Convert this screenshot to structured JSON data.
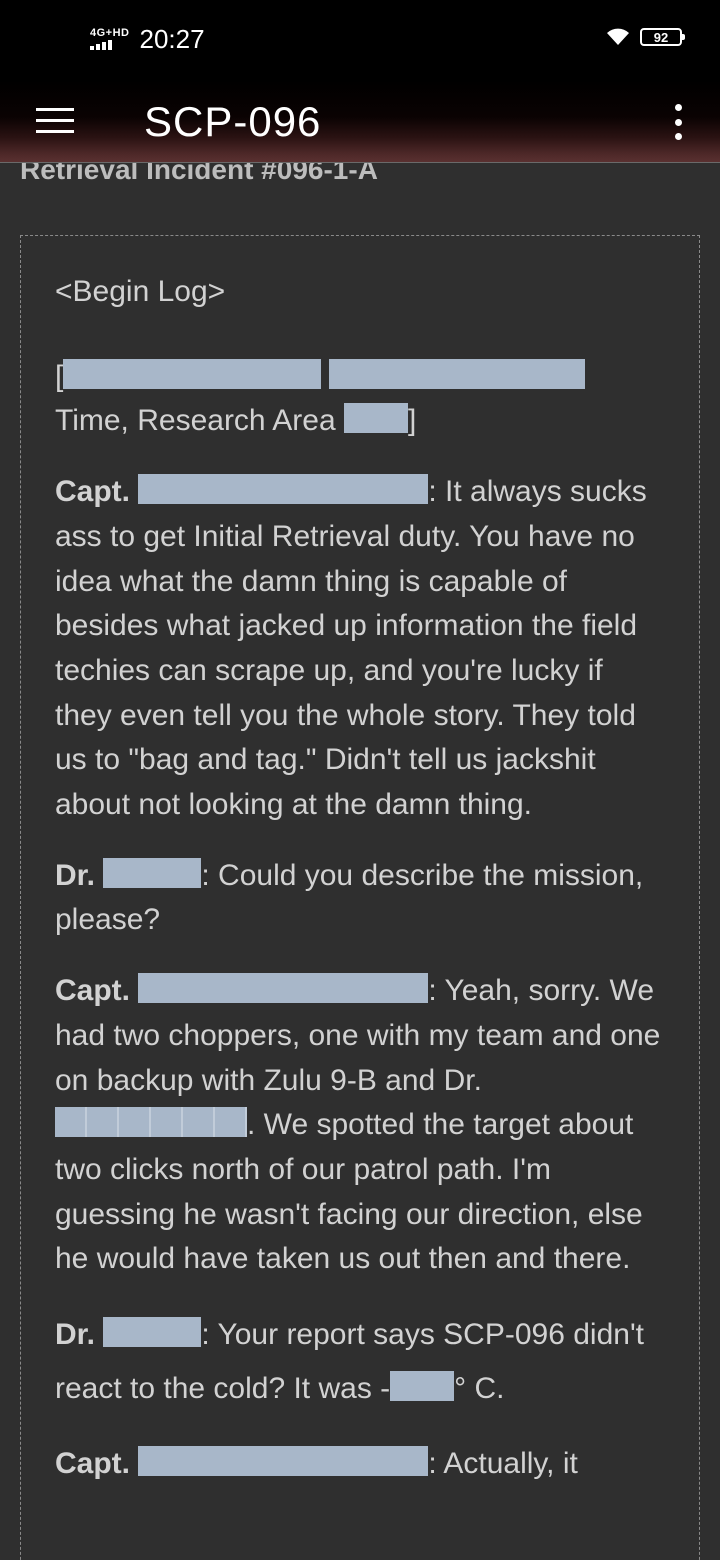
{
  "status_bar": {
    "network": "4G+HD",
    "time": "20:27",
    "battery": "92"
  },
  "app_bar": {
    "title": "SCP-096"
  },
  "article": {
    "section_heading": "Retrieval Incident #096-1-A",
    "begin_log": "<Begin Log>",
    "entries": [
      {
        "speaker": "",
        "line1_prefix": "[",
        "text": "Time, Research Area ",
        "suffix": "]"
      },
      {
        "speaker": "Capt. ",
        "text": ": It always sucks ass to get Initial Retrieval duty. You have no idea what the damn thing is capable of besides what jacked up information the field techies can scrape up, and you're lucky if they even tell you the whole story. They told us to \"bag and tag.\" Didn't tell us jackshit about not looking at the damn thing."
      },
      {
        "speaker": "Dr. ",
        "text": ": Could you describe the mission, please?"
      },
      {
        "speaker": "Capt. ",
        "text_a": ": Yeah, sorry. We had two choppers, one with my team and one on backup with Zulu 9-B and Dr. ",
        "text_b": ". We spotted the target about two clicks north of our patrol path. I'm guessing he wasn't facing our direction, else he would have taken us out then and there."
      },
      {
        "speaker": "Dr. ",
        "text_a": ": Your report says SCP-096 didn't react to the cold? It was -",
        "text_b": "° C."
      },
      {
        "speaker": "Capt. ",
        "text": ": Actually, it"
      }
    ]
  },
  "colors": {
    "background": "#2f2f2f",
    "redaction": "#a8b7c9",
    "text": "#d2d2d2"
  },
  "icons": [
    "menu-icon",
    "more-vert-icon",
    "wifi-icon",
    "signal-icon",
    "battery-icon"
  ]
}
